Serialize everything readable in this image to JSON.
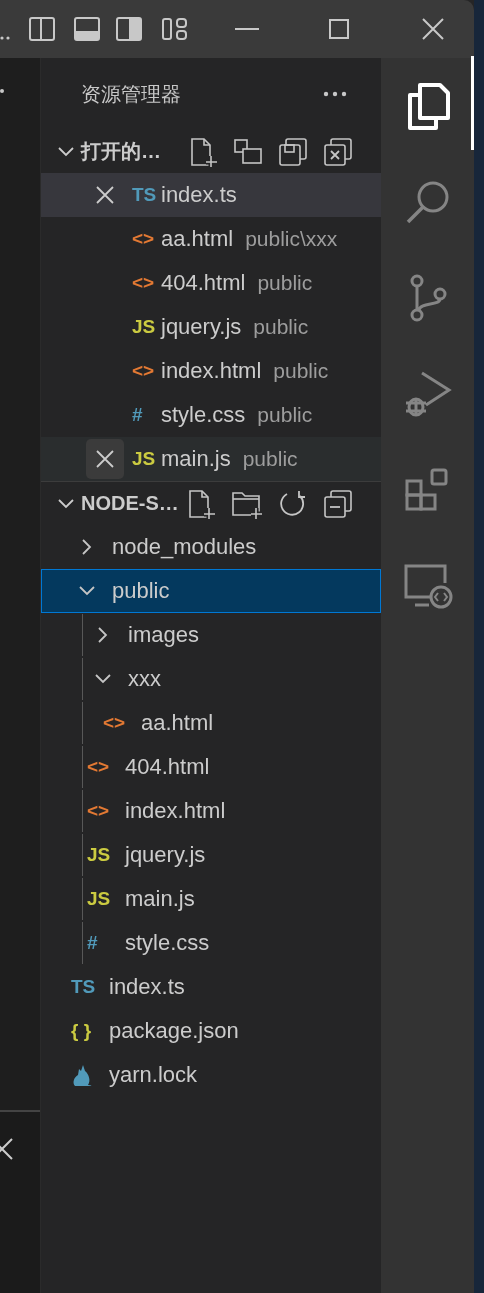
{
  "sidebar": {
    "title": "资源管理器",
    "open_editors": {
      "title": "打开的…",
      "expanded": true,
      "items": [
        {
          "name": "index.ts",
          "icon": "TS",
          "color": "#519aba",
          "selected": true,
          "hovered": false
        },
        {
          "name": "aa.html",
          "description": "public\\xxx",
          "icon": "<>",
          "color": "#e37933",
          "selected": false,
          "hovered": false
        },
        {
          "name": "404.html",
          "description": "public",
          "icon": "<>",
          "color": "#e37933",
          "selected": false,
          "hovered": false
        },
        {
          "name": "jquery.js",
          "description": "public",
          "icon": "JS",
          "color": "#cbcb41",
          "selected": false,
          "hovered": false
        },
        {
          "name": "index.html",
          "description": "public",
          "icon": "<>",
          "color": "#e37933",
          "selected": false,
          "hovered": false
        },
        {
          "name": "style.css",
          "description": "public",
          "icon": "#",
          "color": "#519aba",
          "selected": false,
          "hovered": false
        },
        {
          "name": "main.js",
          "description": "public",
          "icon": "JS",
          "color": "#cbcb41",
          "selected": false,
          "hovered": true
        }
      ]
    },
    "folder": {
      "title": "NODE-S…",
      "expanded": true,
      "items": [
        {
          "kind": "folder",
          "name": "node_modules",
          "expanded": false,
          "selected": false
        },
        {
          "kind": "folder",
          "name": "public",
          "expanded": true,
          "selected": true,
          "children": [
            {
              "kind": "folder",
              "name": "images",
              "expanded": false,
              "selected": false
            },
            {
              "kind": "folder",
              "name": "xxx",
              "expanded": true,
              "selected": false,
              "children": [
                {
                  "kind": "file",
                  "name": "aa.html",
                  "icon": "<>",
                  "color": "#e37933",
                  "selected": false
                }
              ]
            },
            {
              "kind": "file",
              "name": "404.html",
              "icon": "<>",
              "color": "#e37933",
              "selected": false
            },
            {
              "kind": "file",
              "name": "index.html",
              "icon": "<>",
              "color": "#e37933",
              "selected": false
            },
            {
              "kind": "file",
              "name": "jquery.js",
              "icon": "JS",
              "color": "#cbcb41",
              "selected": false
            },
            {
              "kind": "file",
              "name": "main.js",
              "icon": "JS",
              "color": "#cbcb41",
              "selected": false
            },
            {
              "kind": "file",
              "name": "style.css",
              "icon": "#",
              "color": "#519aba",
              "selected": false
            }
          ]
        },
        {
          "kind": "file",
          "name": "index.ts",
          "icon": "TS",
          "color": "#519aba",
          "selected": false
        },
        {
          "kind": "file",
          "name": "package.json",
          "icon": "{ }",
          "color": "#cbcb41",
          "selected": false
        },
        {
          "kind": "file",
          "name": "yarn.lock",
          "color": "#519aba",
          "selected": false
        }
      ]
    }
  },
  "activity_bar": [
    {
      "kind": "explorer",
      "selected": true
    },
    {
      "kind": "search",
      "selected": false
    },
    {
      "kind": "source-control",
      "selected": false
    },
    {
      "kind": "run-debug",
      "selected": false
    },
    {
      "kind": "extensions",
      "selected": false
    },
    {
      "kind": "remote-explorer",
      "selected": false
    }
  ]
}
